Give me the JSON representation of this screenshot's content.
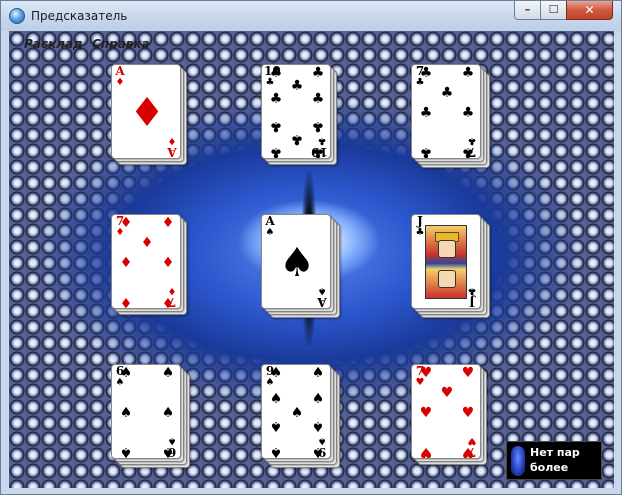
{
  "window": {
    "title": "Предсказатель",
    "controls": {
      "minimize": "–",
      "maximize": "☐",
      "close": "✕"
    }
  },
  "menu": {
    "items": [
      "Расклад",
      "Справка"
    ]
  },
  "stacks": [
    {
      "rank": "A",
      "suit": "♦",
      "color": "red",
      "depth": 3
    },
    {
      "rank": "10",
      "suit": "♣",
      "color": "black",
      "depth": 3
    },
    {
      "rank": "7",
      "suit": "♣",
      "color": "black",
      "depth": 4
    },
    {
      "rank": "7",
      "suit": "♦",
      "color": "red",
      "depth": 3
    },
    {
      "rank": "A",
      "suit": "♠",
      "color": "black",
      "depth": 4
    },
    {
      "rank": "J",
      "suit": "♣",
      "color": "black",
      "depth": 4
    },
    {
      "rank": "6",
      "suit": "♠",
      "color": "black",
      "depth": 4
    },
    {
      "rank": "9",
      "suit": "♠",
      "color": "black",
      "depth": 4
    },
    {
      "rank": "7",
      "suit": "♥",
      "color": "red",
      "depth": 3
    }
  ],
  "status": {
    "text": "Нет пар\nболее",
    "icon": "crystal-icon"
  },
  "colors": {
    "red_suit": "#d60000",
    "black_suit": "#000000",
    "status_bg": "#000000"
  }
}
